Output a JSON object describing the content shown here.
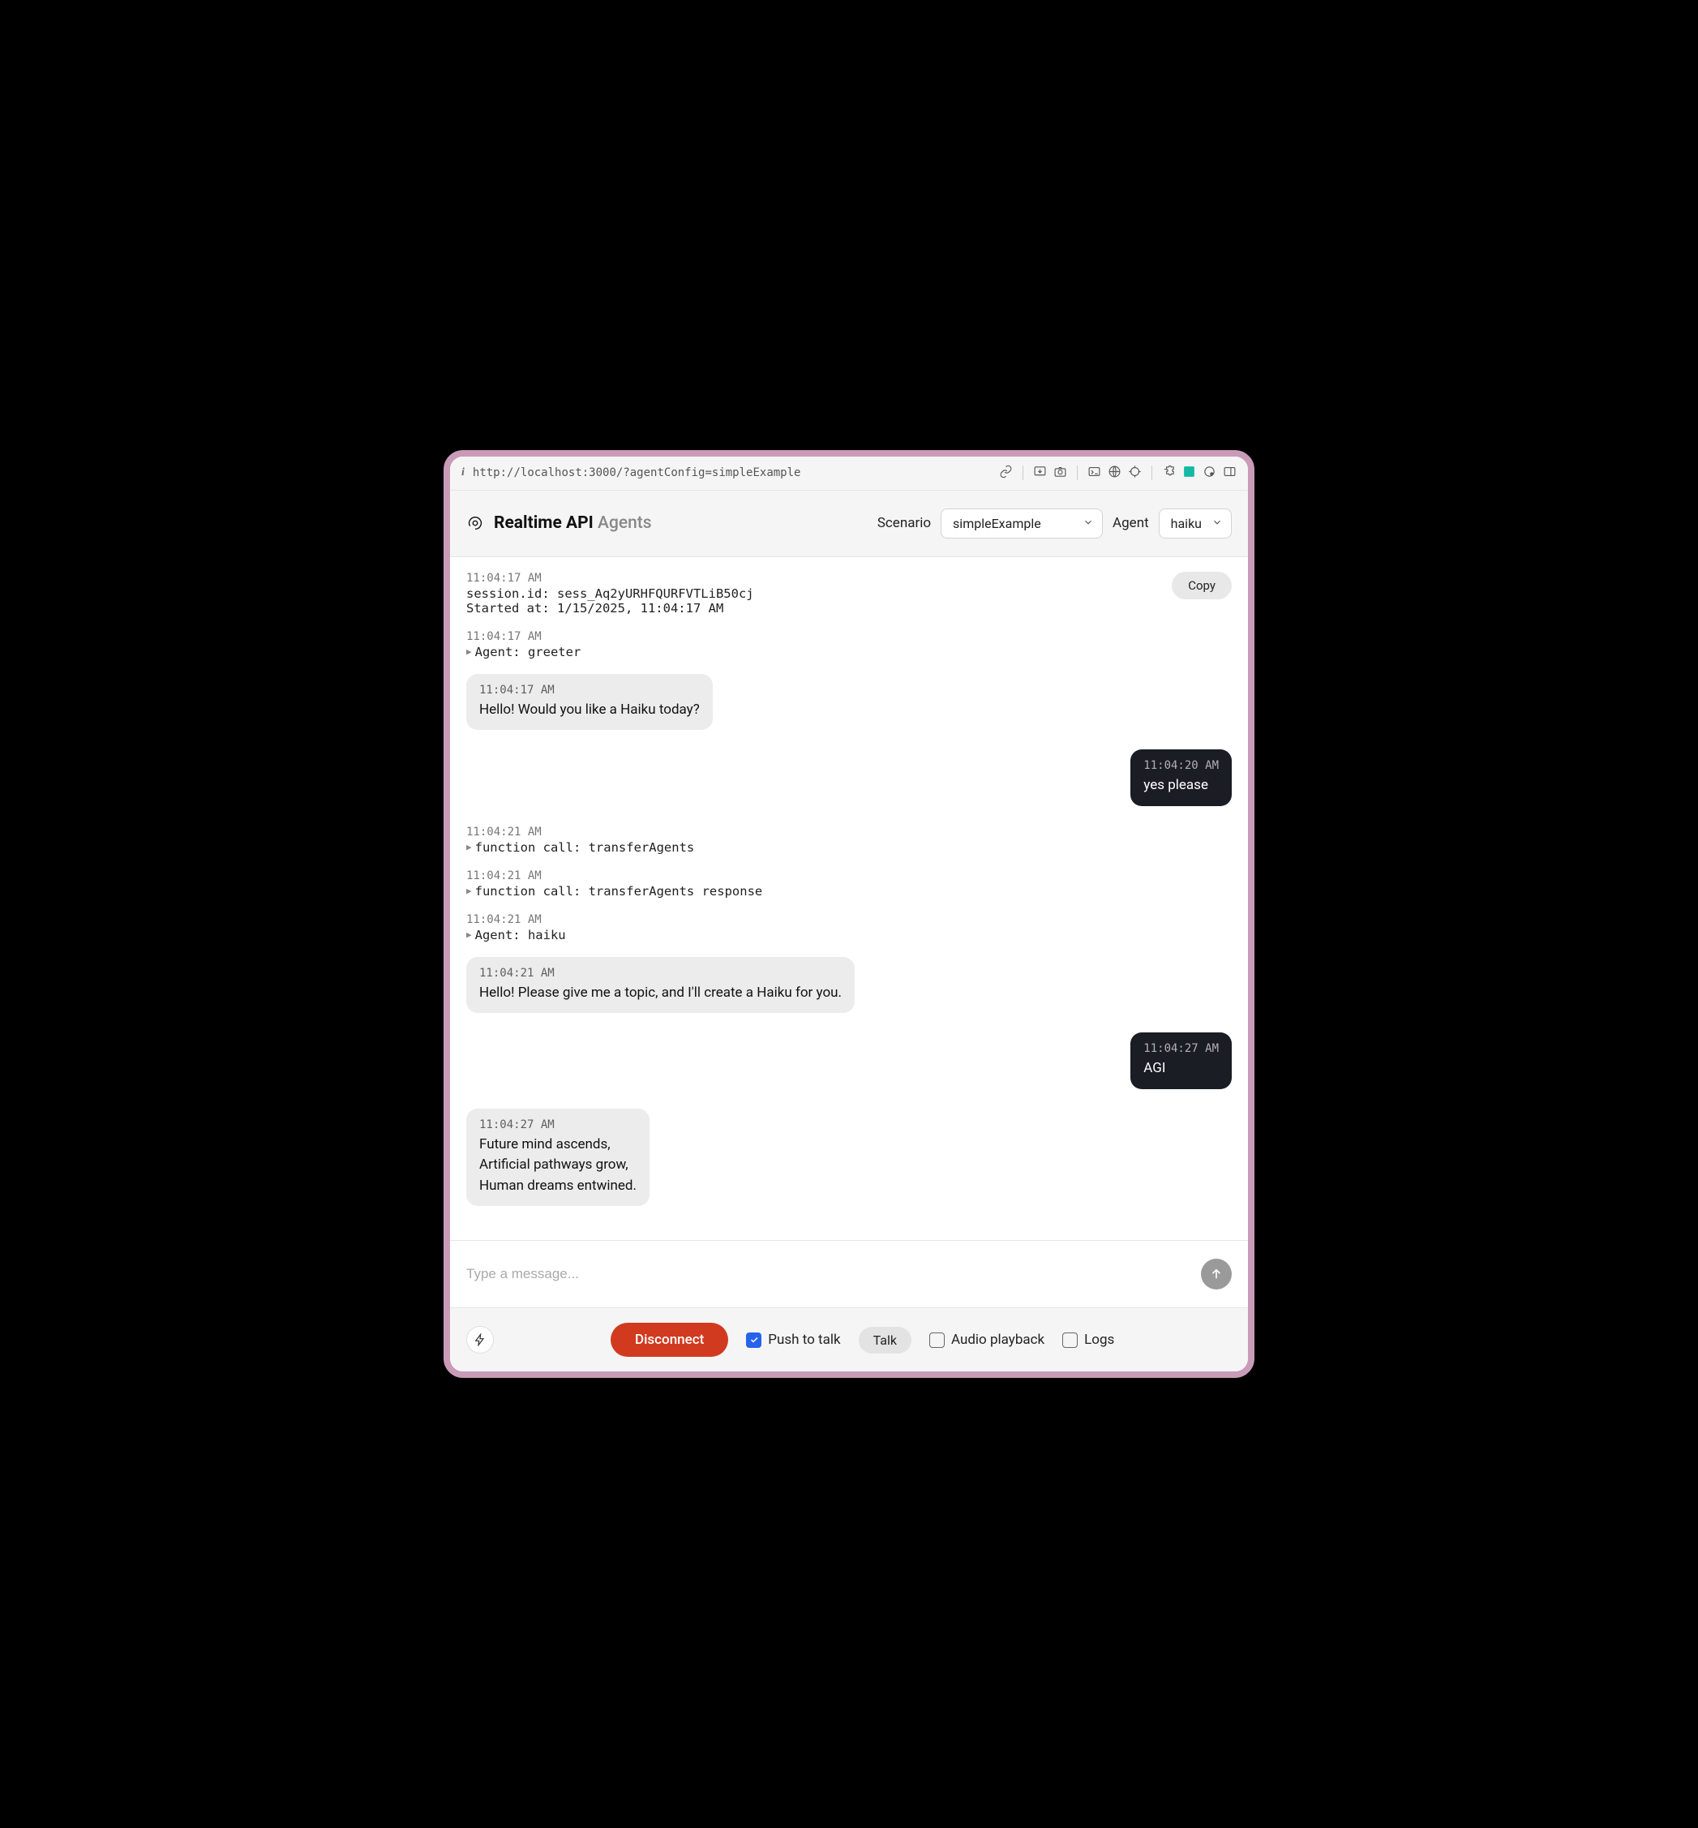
{
  "urlbar": {
    "url": "http://localhost:3000/?agentConfig=simpleExample"
  },
  "header": {
    "title_bold": "Realtime API",
    "title_light": "Agents",
    "scenario_label": "Scenario",
    "scenario_value": "simpleExample",
    "agent_label": "Agent",
    "agent_value": "haiku"
  },
  "copy_label": "Copy",
  "session": {
    "ts": "11:04:17 AM",
    "line1": "session.id: sess_Aq2yURHFQURFVTLiB50cj",
    "line2": "Started at: 1/15/2025, 11:04:17 AM"
  },
  "events": [
    {
      "kind": "log",
      "ts": "11:04:17 AM",
      "text": "Agent: greeter"
    },
    {
      "kind": "bubble",
      "side": "left",
      "ts": "11:04:17 AM",
      "text": "Hello! Would you like a Haiku today?"
    },
    {
      "kind": "bubble",
      "side": "right",
      "ts": "11:04:20 AM",
      "text": "yes please"
    },
    {
      "kind": "log",
      "ts": "11:04:21 AM",
      "text": "function call: transferAgents"
    },
    {
      "kind": "log",
      "ts": "11:04:21 AM",
      "text": "function call: transferAgents response"
    },
    {
      "kind": "log",
      "ts": "11:04:21 AM",
      "text": "Agent: haiku"
    },
    {
      "kind": "bubble",
      "side": "left",
      "ts": "11:04:21 AM",
      "text": "Hello! Please give me a topic, and I'll create a Haiku for you."
    },
    {
      "kind": "bubble",
      "side": "right",
      "ts": "11:04:27 AM",
      "text": "AGI"
    },
    {
      "kind": "bubble",
      "side": "left",
      "ts": "11:04:27 AM",
      "text": "Future mind ascends,\nArtificial pathways grow,\nHuman dreams entwined."
    }
  ],
  "input": {
    "placeholder": "Type a message..."
  },
  "footer": {
    "disconnect": "Disconnect",
    "push_to_talk_label": "Push to talk",
    "push_to_talk_checked": true,
    "talk_label": "Talk",
    "audio_playback_label": "Audio playback",
    "audio_playback_checked": false,
    "logs_label": "Logs",
    "logs_checked": false
  }
}
